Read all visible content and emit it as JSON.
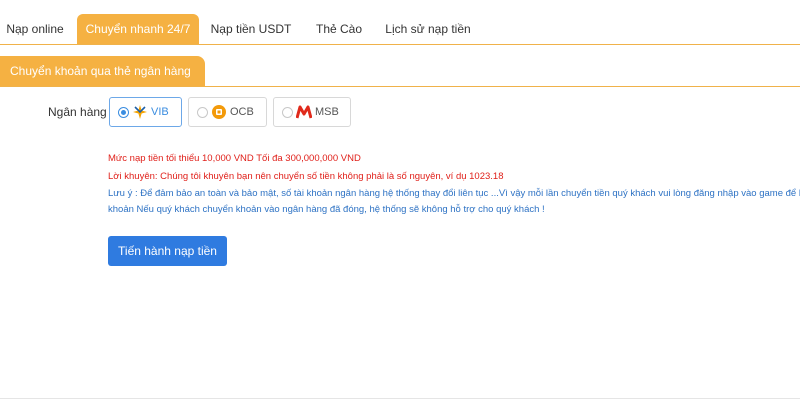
{
  "tabs": [
    {
      "label": "Nạp online",
      "active": false
    },
    {
      "label": "Chuyển nhanh 24/7",
      "active": true
    },
    {
      "label": "Nạp tiền USDT",
      "active": false
    },
    {
      "label": "Thẻ Cào",
      "active": false
    },
    {
      "label": "Lịch sử nạp tiền",
      "active": false
    }
  ],
  "subtab": {
    "label": "Chuyển khoản qua thẻ ngân hàng"
  },
  "bank": {
    "label": "Ngân hàng",
    "options": [
      {
        "name": "VIB",
        "selected": true,
        "icon": "vib-logo-icon"
      },
      {
        "name": "OCB",
        "selected": false,
        "icon": "ocb-logo-icon"
      },
      {
        "name": "MSB",
        "selected": false,
        "icon": "msb-logo-icon"
      }
    ]
  },
  "notices": {
    "limit": "Mức nạp tiền tối thiểu 10,000 VND Tối đa 300,000,000 VND",
    "advice": "Lời khuyên: Chúng tôi khuyên bạn nên chuyển số tiền không phải là số nguyên, ví dụ 1023.18",
    "note_line1": "Lưu ý : Để đảm bảo an toàn và bảo mật, số tài khoản ngân hàng hệ thống thay đổi liên tục ...Vì vậy mỗi lần chuyển tiền quý khách vui lòng đăng nhập vào game để lấy số t",
    "note_line2": "khoản Nếu quý khách chuyển khoản vào ngân hàng đã đóng, hệ thống sẽ không hỗ trợ cho quý khách !"
  },
  "submit_label": "Tiến hành nạp tiền",
  "colors": {
    "accent": "#f5b142",
    "primary": "#2f7be0",
    "warning": "#e0201a",
    "info": "#2d72c4"
  }
}
